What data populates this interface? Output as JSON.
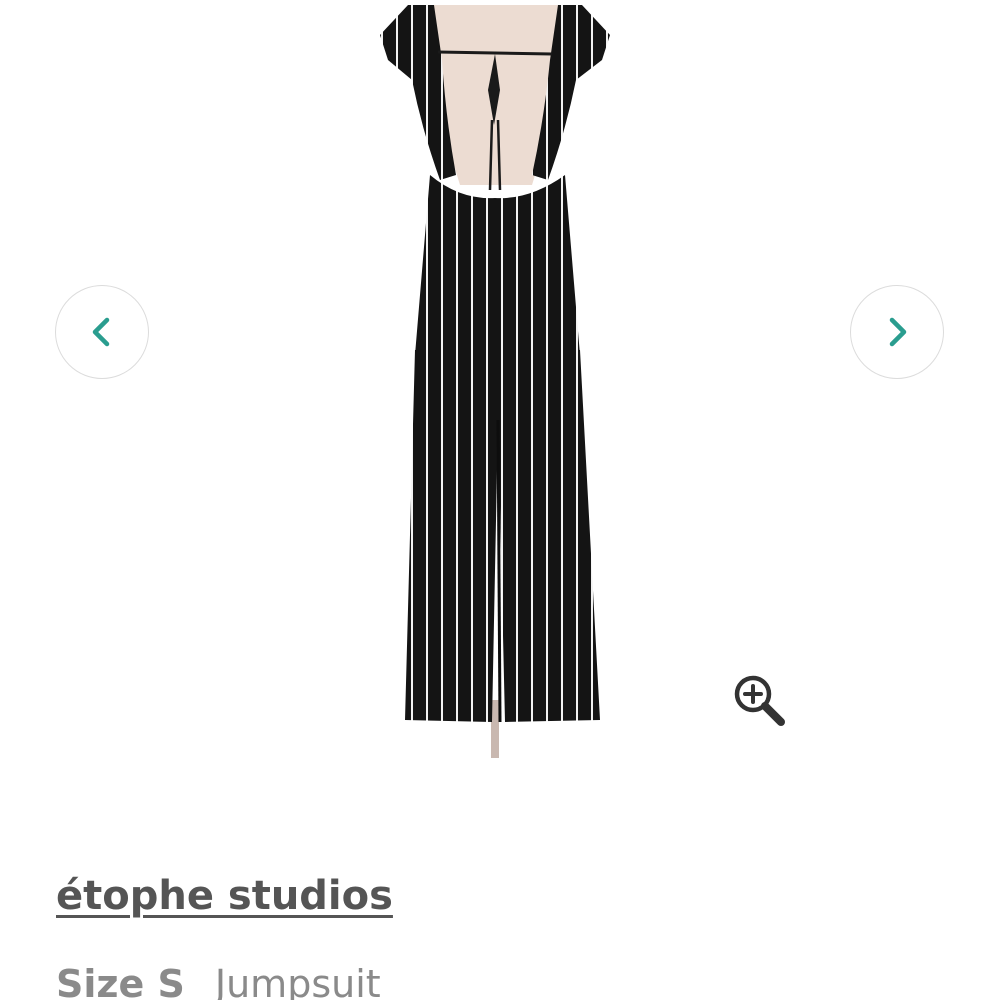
{
  "gallery": {
    "prev_icon": "chevron-left-icon",
    "next_icon": "chevron-right-icon",
    "zoom_icon": "zoom-in-icon",
    "accent_color": "#2a9d8f"
  },
  "product": {
    "brand": "étophe studios",
    "size": "Size S",
    "category": "Jumpsuit"
  }
}
